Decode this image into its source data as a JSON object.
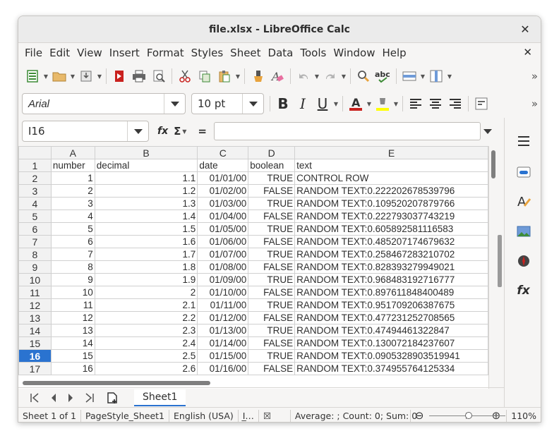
{
  "window": {
    "title": "file.xlsx - LibreOffice Calc",
    "close_glyph": "✕"
  },
  "menubar": {
    "items": [
      "File",
      "Edit",
      "View",
      "Insert",
      "Format",
      "Styles",
      "Sheet",
      "Data",
      "Tools",
      "Window",
      "Help"
    ],
    "close_glyph": "✕"
  },
  "toolbar": {
    "more_glyph": "»",
    "font_name": "Arial",
    "font_size": "10 pt",
    "bold": "B",
    "italic": "I",
    "underline": "U",
    "font_color": "#c9211e",
    "highlight_color": "#ffff00"
  },
  "formula_bar": {
    "name_box": "I16",
    "fx_label": "fx",
    "sigma_label": "Σ",
    "equals_label": "=",
    "value": ""
  },
  "grid": {
    "columns": [
      "A",
      "B",
      "C",
      "D",
      "E"
    ],
    "selected_row": "16",
    "rows": [
      {
        "n": "1",
        "cells": [
          "number",
          "decimal",
          "date",
          "boolean",
          "text"
        ]
      },
      {
        "n": "2",
        "cells": [
          "1",
          "1.1",
          "01/01/00",
          "TRUE",
          "CONTROL ROW"
        ]
      },
      {
        "n": "3",
        "cells": [
          "2",
          "1.2",
          "01/02/00",
          "FALSE",
          "RANDOM TEXT:0.222202678539796"
        ]
      },
      {
        "n": "4",
        "cells": [
          "3",
          "1.3",
          "01/03/00",
          "TRUE",
          "RANDOM TEXT:0.109520207879766"
        ]
      },
      {
        "n": "5",
        "cells": [
          "4",
          "1.4",
          "01/04/00",
          "FALSE",
          "RANDOM TEXT:0.222793037743219"
        ]
      },
      {
        "n": "6",
        "cells": [
          "5",
          "1.5",
          "01/05/00",
          "TRUE",
          "RANDOM TEXT:0.605892581116583"
        ]
      },
      {
        "n": "7",
        "cells": [
          "6",
          "1.6",
          "01/06/00",
          "FALSE",
          "RANDOM TEXT:0.485207174679632"
        ]
      },
      {
        "n": "8",
        "cells": [
          "7",
          "1.7",
          "01/07/00",
          "TRUE",
          "RANDOM TEXT:0.258467283210702"
        ]
      },
      {
        "n": "9",
        "cells": [
          "8",
          "1.8",
          "01/08/00",
          "FALSE",
          "RANDOM TEXT:0.828393279949021"
        ]
      },
      {
        "n": "10",
        "cells": [
          "9",
          "1.9",
          "01/09/00",
          "TRUE",
          "RANDOM TEXT:0.968483192716777"
        ]
      },
      {
        "n": "11",
        "cells": [
          "10",
          "2",
          "01/10/00",
          "FALSE",
          "RANDOM TEXT:0.897611848400489"
        ]
      },
      {
        "n": "12",
        "cells": [
          "11",
          "2.1",
          "01/11/00",
          "TRUE",
          "RANDOM TEXT:0.951709206387675"
        ]
      },
      {
        "n": "13",
        "cells": [
          "12",
          "2.2",
          "01/12/00",
          "FALSE",
          "RANDOM TEXT:0.477231252708565"
        ]
      },
      {
        "n": "14",
        "cells": [
          "13",
          "2.3",
          "01/13/00",
          "TRUE",
          "RANDOM TEXT:0.47494461322847"
        ]
      },
      {
        "n": "15",
        "cells": [
          "14",
          "2.4",
          "01/14/00",
          "FALSE",
          "RANDOM TEXT:0.130072184237607"
        ]
      },
      {
        "n": "16",
        "cells": [
          "15",
          "2.5",
          "01/15/00",
          "TRUE",
          "RANDOM TEXT:0.0905328903519941"
        ]
      },
      {
        "n": "17",
        "cells": [
          "16",
          "2.6",
          "01/16/00",
          "FALSE",
          "RANDOM TEXT:0.374955764125334"
        ]
      }
    ]
  },
  "sheets": {
    "active": "Sheet1"
  },
  "statusbar": {
    "sheet": "Sheet 1 of 1",
    "page_style": "PageStyle_Sheet1",
    "language": "English (USA)",
    "insert_mode": "I̲…",
    "signature": "☒",
    "summary": "Average: ; Count: 0; Sum: 0",
    "zoom_minus": "⊖",
    "zoom_plus": "⊕",
    "zoom": "110%",
    "zoom_level_percent": 110
  }
}
